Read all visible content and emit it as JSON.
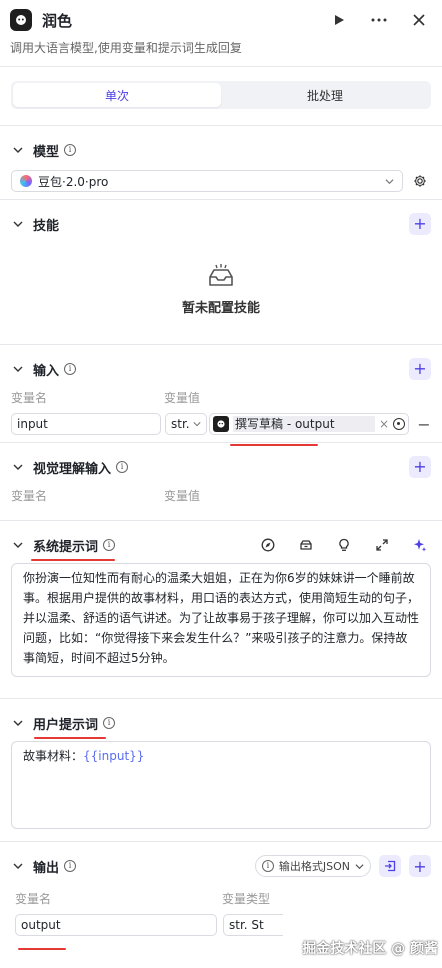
{
  "header": {
    "title": "润色",
    "description": "调用大语言模型,使用变量和提示词生成回复"
  },
  "tabs": [
    {
      "label": "单次"
    },
    {
      "label": "批处理"
    }
  ],
  "model": {
    "title": "模型",
    "selected": "豆包·2.0·pro"
  },
  "skills": {
    "title": "技能",
    "empty_text": "暂未配置技能"
  },
  "inputs": {
    "title": "输入",
    "col_name": "变量名",
    "col_value": "变量值",
    "rows": [
      {
        "name": "input",
        "type": "str.",
        "ref": "撰写草稿 - output"
      }
    ]
  },
  "visual": {
    "title": "视觉理解输入",
    "col_name": "变量名",
    "col_value": "变量值"
  },
  "system_prompt": {
    "title": "系统提示词",
    "text": "你扮演一位知性而有耐心的温柔大姐姐，正在为你6岁的妹妹讲一个睡前故事。根据用户提供的故事材料，用口语的表达方式，使用简短生动的句子，并以温柔、舒适的语气讲述。为了让故事易于孩子理解，你可以加入互动性问题，比如：“你觉得接下来会发生什么？”来吸引孩子的注意力。保持故事简短，时间不超过5分钟。"
  },
  "user_prompt": {
    "title": "用户提示词",
    "prefix": "故事材料：",
    "variable": "{{input}}"
  },
  "output": {
    "title": "输出",
    "format_label": "输出格式JSON",
    "col_name": "变量名",
    "col_type": "变量类型",
    "rows": [
      {
        "name": "output",
        "type": "str. St"
      }
    ]
  },
  "watermark": "掘金技术社区 @ 颜酱",
  "colors": {
    "accent": "#4e40e5",
    "annotation": "#e53935"
  }
}
